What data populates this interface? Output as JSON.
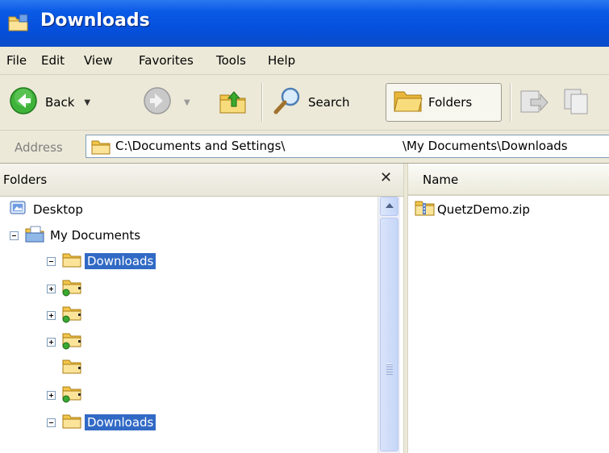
{
  "window": {
    "title": "Downloads"
  },
  "menu": [
    "File",
    "Edit",
    "View",
    "Favorites",
    "Tools",
    "Help"
  ],
  "toolbar": {
    "back_label": "Back",
    "search_label": "Search",
    "folders_label": "Folders"
  },
  "address": {
    "label": "Address",
    "path_part1": "C:\\Documents and Settings\\",
    "path_part2": "\\My Documents\\Downloads"
  },
  "folders_pane": {
    "title": "Folders",
    "close_glyph": "✕",
    "tree": [
      {
        "label": "Desktop",
        "expander": "none",
        "selected": false
      },
      {
        "label": "My Documents",
        "expander": "minus",
        "selected": false
      },
      {
        "label": "Downloads",
        "expander": "minus",
        "selected": true
      },
      {
        "label": "",
        "expander": "plus",
        "selected": false
      },
      {
        "label": "",
        "expander": "plus",
        "selected": false
      },
      {
        "label": "",
        "expander": "plus",
        "selected": false
      },
      {
        "label": "",
        "expander": "none",
        "selected": false
      },
      {
        "label": "",
        "expander": "plus",
        "selected": false
      },
      {
        "label": "Downloads",
        "expander": "minus",
        "selected": true
      }
    ]
  },
  "file_list": {
    "column_name": "Name",
    "files": [
      {
        "name": "QuetzDemo.zip"
      }
    ]
  },
  "colors": {
    "title_bar": "#0550dd",
    "selection": "#316ac5",
    "chrome": "#ece9d8"
  }
}
